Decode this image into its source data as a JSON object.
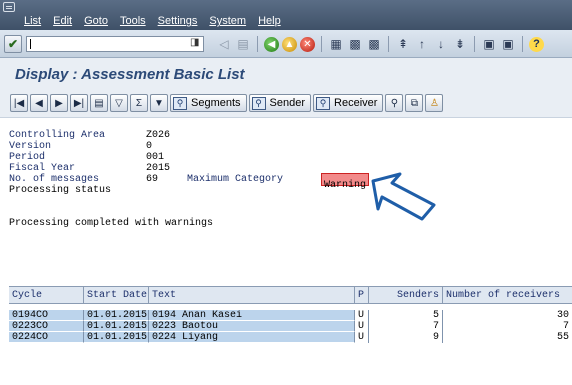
{
  "menu": {
    "items": [
      "List",
      "Edit",
      "Goto",
      "Tools",
      "Settings",
      "System",
      "Help"
    ]
  },
  "title": "Display : Assessment Basic List",
  "toolbar": {
    "segments_label": "Segments",
    "sender_label": "Sender",
    "receiver_label": "Receiver"
  },
  "header": {
    "controlling_area_label": "Controlling Area",
    "controlling_area_value": "Z026",
    "version_label": "Version",
    "version_value": "0",
    "period_label": "Period",
    "period_value": "001",
    "fiscal_year_label": "Fiscal Year",
    "fiscal_year_value": "2015",
    "messages_label": "No. of messages",
    "messages_value": "69",
    "max_category_label": "Maximum Category",
    "max_category_value": "Warning",
    "processing_status_label": "Processing status",
    "status_message": "Processing completed with warnings"
  },
  "table": {
    "columns": [
      "Cycle",
      "Start Date",
      "Text",
      "P",
      "Senders",
      "Number of receivers"
    ],
    "rows": [
      {
        "cycle": "0194CO",
        "start_date": "01.01.2015",
        "text": "0194 Anan Kasei",
        "p": "U",
        "senders": "5",
        "receivers": "30"
      },
      {
        "cycle": "0223CO",
        "start_date": "01.01.2015",
        "text": "0223 Baotou",
        "p": "U",
        "senders": "7",
        "receivers": "7"
      },
      {
        "cycle": "0224CO",
        "start_date": "01.01.2015",
        "text": "0224 Liyang",
        "p": "U",
        "senders": "9",
        "receivers": "55"
      }
    ]
  },
  "colors": {
    "warning_highlight": "#f28a8a",
    "title": "#2c4a78",
    "menubar": "#4b5d77",
    "row_highlight": "#bcd4ec"
  }
}
